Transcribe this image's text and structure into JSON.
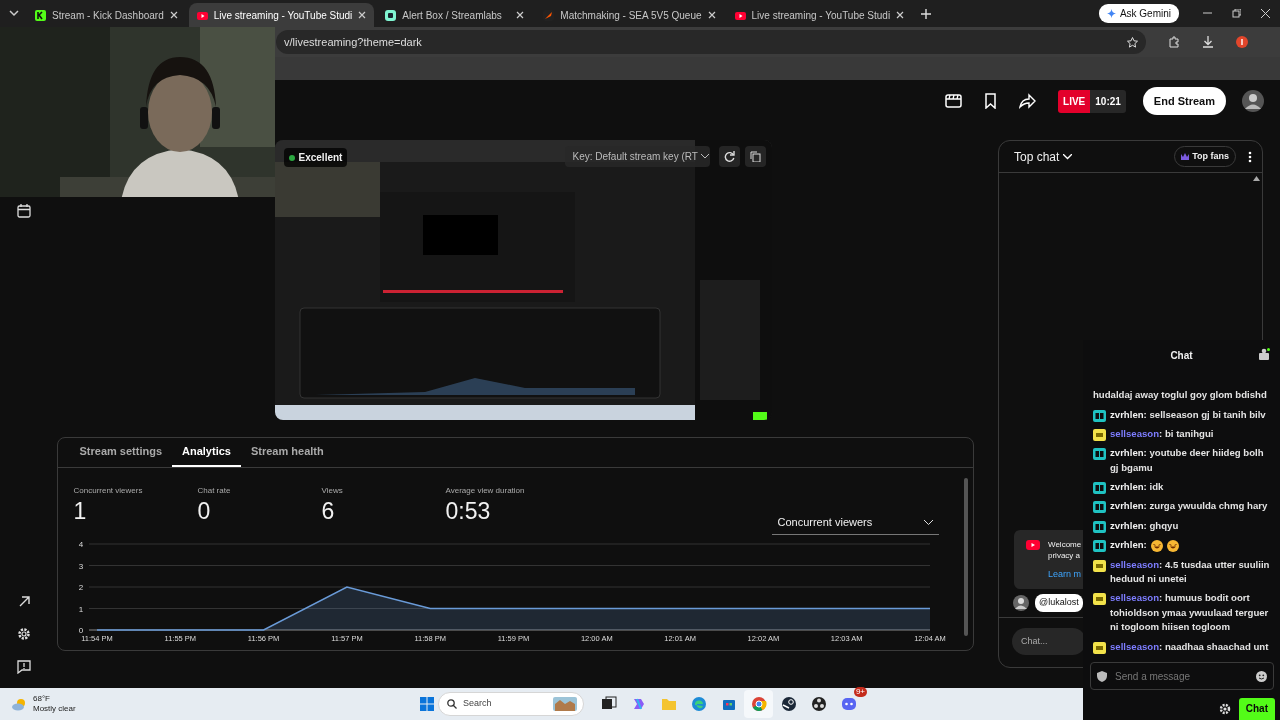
{
  "browser": {
    "tabs": [
      {
        "title": "Stream - Kick Dashboard",
        "selected": false
      },
      {
        "title": "Live streaming - YouTube Studi",
        "selected": true
      },
      {
        "title": "Alert Box / Streamlabs",
        "selected": false
      },
      {
        "title": "Matchmaking - SEA 5V5 Queue",
        "selected": false
      },
      {
        "title": "Live streaming - YouTube Studi",
        "selected": false
      }
    ],
    "ask_button": "Ask Gemini",
    "url": "v/livestreaming?theme=dark"
  },
  "header": {
    "live_label": "LIVE",
    "live_time": "10:21",
    "end_button": "End Stream"
  },
  "preview": {
    "health": "Excellent",
    "key_select": "Key: Default stream key (RT"
  },
  "analytics": {
    "tabs": [
      {
        "label": "Stream settings",
        "selected": false
      },
      {
        "label": "Analytics",
        "selected": true
      },
      {
        "label": "Stream health",
        "selected": false
      }
    ],
    "stats": [
      {
        "label": "Concurrent viewers",
        "value": "1"
      },
      {
        "label": "Chat rate",
        "value": "0"
      },
      {
        "label": "Views",
        "value": "6"
      },
      {
        "label": "Average view duration",
        "value": "0:53"
      }
    ],
    "metric_select": "Concurrent viewers",
    "chart_data": {
      "type": "area",
      "categories": [
        "11:54 PM",
        "11:55 PM",
        "11:56 PM",
        "11:57 PM",
        "11:58 PM",
        "11:59 PM",
        "12:00 AM",
        "12:01 AM",
        "12:02 AM",
        "12:03 AM",
        "12:04 AM"
      ],
      "series": [
        {
          "color": "#6a9bd8",
          "values": [
            0,
            0,
            0,
            2,
            1,
            1,
            1,
            1,
            1,
            1,
            1
          ]
        }
      ],
      "ylim": [
        0,
        4
      ],
      "yticks": [
        0,
        1,
        2,
        3,
        4
      ],
      "grid": true
    }
  },
  "chat_panel": {
    "title": "Top chat",
    "top_fans": "Top fans",
    "notice_lines": [
      "Welcome",
      "privacy a"
    ],
    "notice_link": "Learn m",
    "mention": "@lukalost",
    "input_placeholder": "Chat..."
  },
  "popout_chat": {
    "title": "Chat",
    "messages": [
      {
        "text": "hudaldaj away toglul goy glom bdishd"
      },
      {
        "kind": "gift",
        "user": "zvrhlen:",
        "color": "#f2f2f2",
        "text": "sellseason gj bi tanih bilv"
      },
      {
        "kind": "tier",
        "user": "sellseason",
        "color": "#7d7dff",
        "text": ": bi tanihgui"
      },
      {
        "kind": "gift",
        "user": "zvrhlen:",
        "color": "#f2f2f2",
        "text": "youtube deer hiideg bolh gj bgamu"
      },
      {
        "kind": "gift",
        "user": "zvrhlen:",
        "color": "#f2f2f2",
        "text": "idk"
      },
      {
        "kind": "gift",
        "user": "zvrhlen:",
        "color": "#f2f2f2",
        "text": "zurga ywuulda chmg hary"
      },
      {
        "kind": "gift",
        "user": "zvrhlen:",
        "color": "#f2f2f2",
        "text": "ghqyu"
      },
      {
        "kind": "gift",
        "user": "zvrhlen:",
        "color": "#f2f2f2",
        "emotes": [
          {
            "kind": "laugh"
          },
          {
            "kind": "laugh"
          }
        ]
      },
      {
        "kind": "tier",
        "user": "sellseason",
        "color": "#7d7dff",
        "text": ": 4.5 tusdaa utter suuliin heduud ni unetei"
      },
      {
        "kind": "tier",
        "user": "sellseason",
        "color": "#7d7dff",
        "text": ": humuus bodit oort tohioldson ymaa ywuulaad terguer ni togloom hiisen togloom"
      },
      {
        "kind": "tier",
        "user": "sellseason",
        "color": "#7d7dff",
        "text": ": naadhaa shaachad unt"
      }
    ],
    "input_placeholder": "Send a message",
    "send_button": "Chat"
  },
  "taskbar": {
    "temperature": "68°F",
    "weather": "Mostly clear",
    "search_placeholder": "Search",
    "apps": [
      {
        "kind": "taskview",
        "selected": false
      },
      {
        "kind": "copilot",
        "selected": false
      },
      {
        "kind": "explorer",
        "selected": false
      },
      {
        "kind": "edge",
        "selected": false
      },
      {
        "kind": "store",
        "selected": false
      },
      {
        "kind": "chrome",
        "selected": true
      },
      {
        "kind": "steam",
        "selected": false
      },
      {
        "kind": "obs",
        "selected": false
      },
      {
        "kind": "discord",
        "selected": false,
        "badge": "9+"
      }
    ]
  }
}
